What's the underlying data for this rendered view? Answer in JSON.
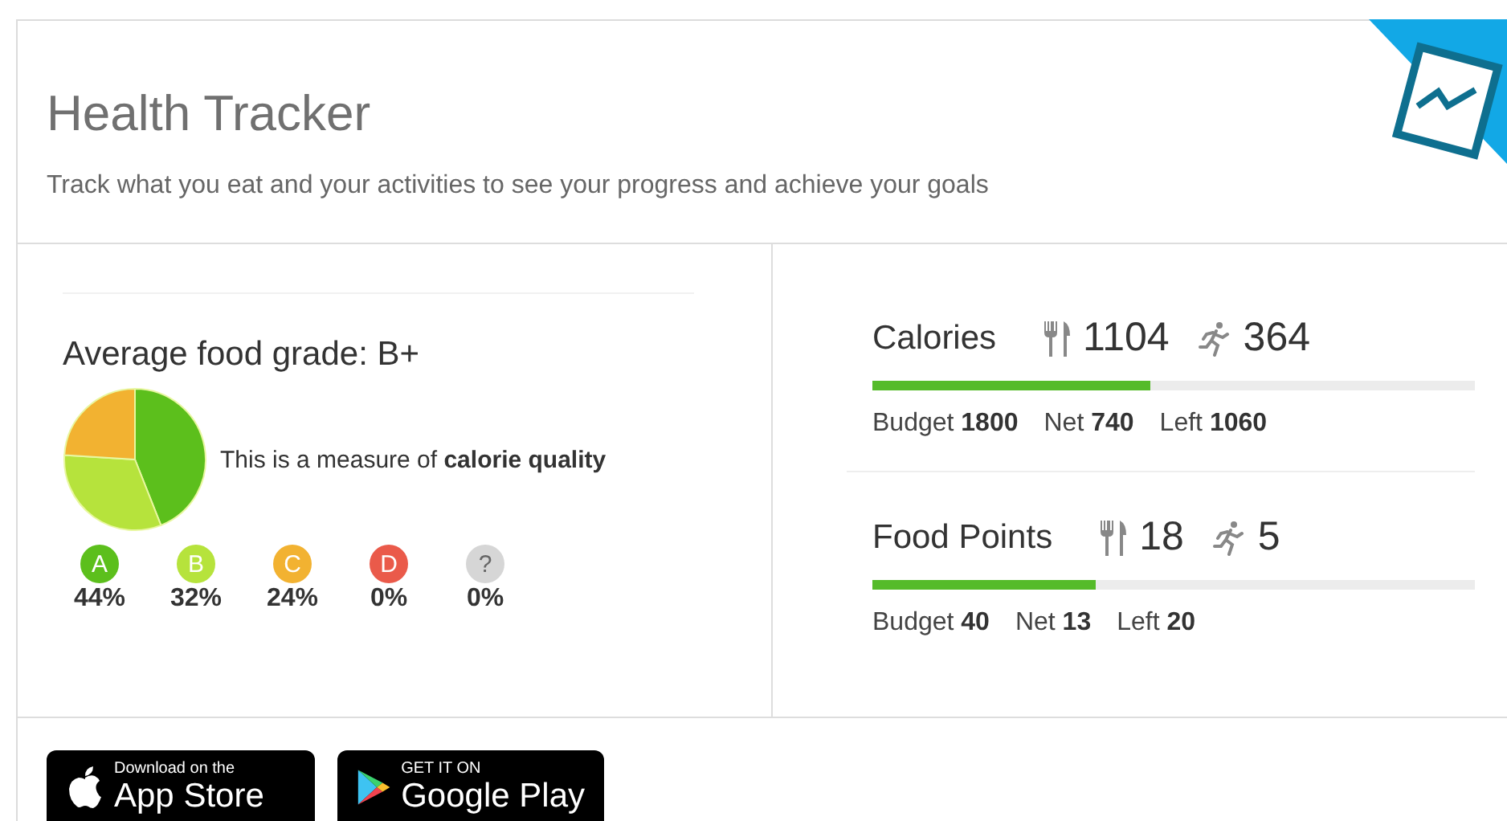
{
  "header": {
    "title": "Health Tracker",
    "subtitle": "Track what you eat and your activities to see your progress and achieve your goals"
  },
  "food_grade": {
    "title": "Average food grade: B+",
    "caption": "This is a measure of **calorie quality**",
    "chart_data": {
      "type": "pie",
      "categories": [
        "A",
        "B",
        "C",
        "D",
        "?"
      ],
      "series": [
        {
          "values": [
            44,
            32,
            24,
            0,
            0
          ]
        }
      ]
    },
    "grades": [
      {
        "percent": "44%",
        "color": "#5cbf1c"
      },
      {
        "percent": "32%",
        "color": "#b6e33c"
      },
      {
        "percent": "24%",
        "color": "#f2b231"
      },
      {
        "percent": "0%",
        "color": "#ea5a4a"
      },
      {
        "percent": "0%",
        "color": "#d6d6d6"
      }
    ]
  },
  "metrics": [
    {
      "title": "Calories",
      "eaten": "1104",
      "burned": "364",
      "level": 0.46,
      "stats": [
        "Budget **1800**",
        "Net **740**",
        "Left **1060**"
      ]
    },
    {
      "title": "Food Points",
      "eaten": "18",
      "burned": "5",
      "level": 0.37,
      "stats": [
        "Budget **40**",
        "Net **13**",
        "Left **20**"
      ]
    }
  ],
  "store_badges": [
    {
      "kind": "apple",
      "small": "Download on the",
      "large": "App Store"
    },
    {
      "kind": "google",
      "small": "GET IT ON",
      "large": "Google Play"
    }
  ]
}
